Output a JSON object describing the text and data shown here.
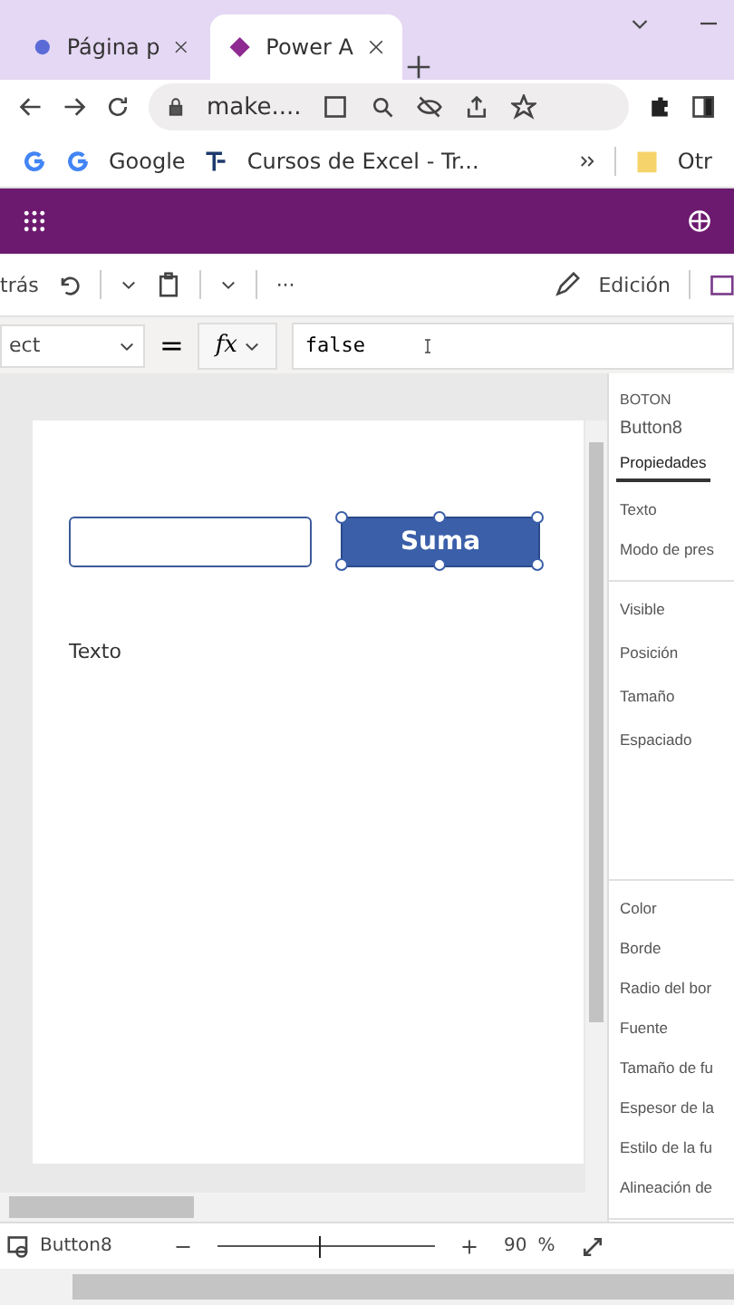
{
  "browser": {
    "tabs": [
      {
        "label": "Página p",
        "selected": false
      },
      {
        "label": "Power A",
        "selected": true
      }
    ],
    "address": "make....",
    "bookmarks": [
      {
        "label": "Google"
      },
      {
        "label": "Cursos de Excel - Tr..."
      }
    ],
    "other_bookmarks": "Otr"
  },
  "command_bar": {
    "back": "trás",
    "more": "···",
    "edit": "Edición"
  },
  "formula_bar": {
    "property": "ect",
    "equals": "=",
    "fx": "fx",
    "formula": "false"
  },
  "canvas": {
    "button": "Suma",
    "label": "Texto"
  },
  "properties": {
    "type": "BOTON",
    "name": "Button8",
    "tabs": [
      {
        "label": "Propiedades",
        "selected": true
      }
    ],
    "groups": [
      [
        "Texto",
        "Modo de pres"
      ],
      [
        "Visible",
        "Posición",
        "Tamaño",
        "Espaciado"
      ],
      [
        "Color",
        "Borde",
        "Radio del bor",
        "Fuente",
        "Tamaño de fu",
        "Espesor de la",
        "Estilo de la fu",
        "Alineación de"
      ]
    ]
  },
  "status": {
    "control": "Button8",
    "zoom": {
      "level": 0.47
    },
    "zoom_value": "90",
    "percent": "%"
  }
}
